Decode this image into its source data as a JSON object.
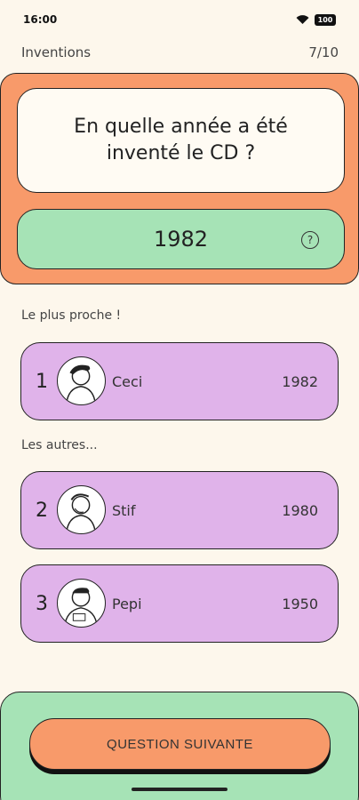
{
  "status_bar": {
    "time": "16:00",
    "battery": "100"
  },
  "header": {
    "category": "Inventions",
    "progress": "7/10"
  },
  "question": {
    "text": "En quelle année a été inventé le CD ?",
    "answer": "1982",
    "help_glyph": "?"
  },
  "closest": {
    "label": "Le plus proche !",
    "player": {
      "rank": "1",
      "name": "Ceci",
      "year": "1982",
      "avatar": "person-avatar"
    }
  },
  "others": {
    "label": "Les autres...",
    "players": [
      {
        "rank": "2",
        "name": "Stif",
        "year": "1980",
        "avatar": "person-avatar"
      },
      {
        "rank": "3",
        "name": "Pepi",
        "year": "1950",
        "avatar": "person-avatar"
      }
    ]
  },
  "footer": {
    "next_label": "QUESTION SUIVANTE"
  },
  "colors": {
    "background": "#fdf7ec",
    "orange": "#f89a6a",
    "green": "#a6e3b6",
    "purple": "#e0b3ea"
  }
}
